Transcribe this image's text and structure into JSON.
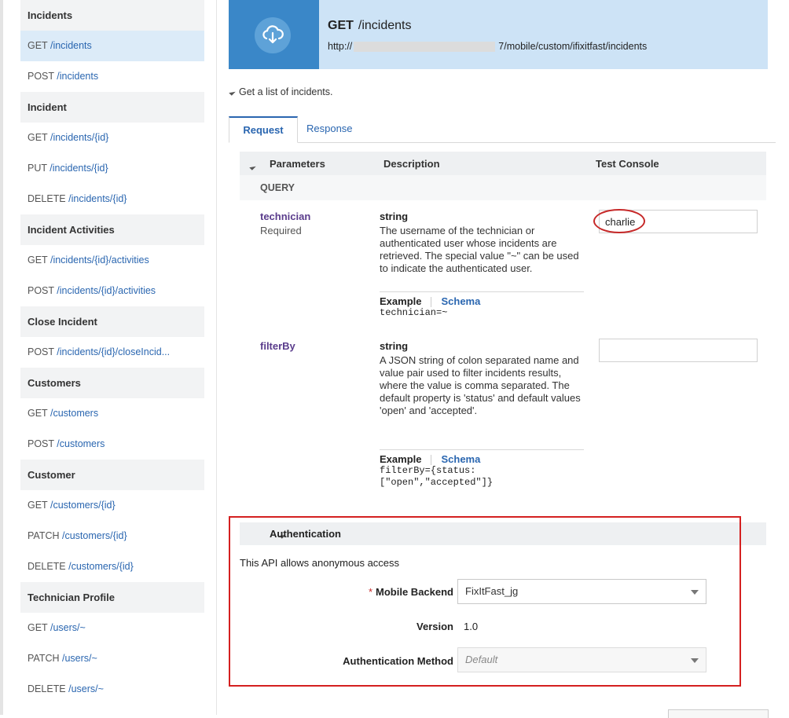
{
  "sidebar": {
    "items": [
      {
        "type": "group",
        "label": "Incidents"
      },
      {
        "type": "link",
        "method": "GET",
        "path": "/incidents",
        "active": true
      },
      {
        "type": "link",
        "method": "POST",
        "path": "/incidents"
      },
      {
        "type": "group",
        "label": "Incident"
      },
      {
        "type": "link",
        "method": "GET",
        "path": "/incidents/{id}"
      },
      {
        "type": "link",
        "method": "PUT",
        "path": "/incidents/{id}"
      },
      {
        "type": "link",
        "method": "DELETE",
        "path": "/incidents/{id}"
      },
      {
        "type": "group",
        "label": "Incident Activities"
      },
      {
        "type": "link",
        "method": "GET",
        "path": "/incidents/{id}/activities"
      },
      {
        "type": "link",
        "method": "POST",
        "path": "/incidents/{id}/activities"
      },
      {
        "type": "group",
        "label": "Close Incident"
      },
      {
        "type": "link",
        "method": "POST",
        "path": "/incidents/{id}/closeIncid..."
      },
      {
        "type": "group",
        "label": "Customers"
      },
      {
        "type": "link",
        "method": "GET",
        "path": "/customers"
      },
      {
        "type": "link",
        "method": "POST",
        "path": "/customers"
      },
      {
        "type": "group",
        "label": "Customer"
      },
      {
        "type": "link",
        "method": "GET",
        "path": "/customers/{id}"
      },
      {
        "type": "link",
        "method": "PATCH",
        "path": "/customers/{id}"
      },
      {
        "type": "link",
        "method": "DELETE",
        "path": "/customers/{id}"
      },
      {
        "type": "group",
        "label": "Technician Profile"
      },
      {
        "type": "link",
        "method": "GET",
        "path": "/users/~"
      },
      {
        "type": "link",
        "method": "PATCH",
        "path": "/users/~"
      },
      {
        "type": "link",
        "method": "DELETE",
        "path": "/users/~"
      }
    ]
  },
  "header": {
    "method": "GET",
    "path": "/incidents",
    "url_prefix": "http://",
    "url_suffix": "7/mobile/custom/ifixitfast/incidents",
    "icon": "cloud-download-icon"
  },
  "summary": "Get a list of incidents.",
  "tabs": {
    "request": "Request",
    "response": "Response"
  },
  "params_table": {
    "col_parameters": "Parameters",
    "col_description": "Description",
    "col_test_console": "Test Console",
    "section": "QUERY"
  },
  "params": [
    {
      "name": "technician",
      "required": "Required",
      "type": "string",
      "description": "The username of the technician or authenticated user whose incidents are retrieved. The special value \"~\" can be used to indicate the authenticated user.",
      "example_label": "Example",
      "schema_label": "Schema",
      "example": "technician=~",
      "value": "charlie"
    },
    {
      "name": "filterBy",
      "type": "string",
      "description": "A JSON string of colon separated name and value pair used to filter incidents results, where the value is comma separated. The default property is 'status' and default values 'open' and 'accepted'.",
      "example_label": "Example",
      "schema_label": "Schema",
      "example": "filterBy={status:\n[\"open\",\"accepted\"]}",
      "value": ""
    }
  ],
  "auth": {
    "title": "Authentication",
    "anon_text": "This API allows anonymous access",
    "backend_label": "Mobile Backend",
    "backend_value": "FixItFast_jg",
    "version_label": "Version",
    "version_value": "1.0",
    "method_label": "Authentication Method",
    "method_value": "Default"
  },
  "colors": {
    "accent": "#2a66b0",
    "header_bg": "#cde3f6",
    "icon_box": "#3a87c8",
    "highlight": "#d42020"
  }
}
